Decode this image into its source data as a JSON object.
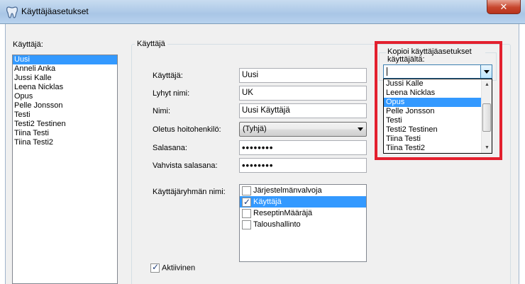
{
  "window": {
    "title": "Käyttäjäasetukset",
    "close_label": "✕"
  },
  "user_list": {
    "label": "Käyttäjä:",
    "items": [
      "Uusi",
      "Anneli Anka",
      "Jussi Kalle",
      "Leena Nicklas",
      "Opus",
      "Pelle Jonsson",
      "Testi",
      "Testi2 Testinen",
      "Tiina Testi",
      "Tiina Testi2"
    ],
    "selected_index": 0
  },
  "user_group": {
    "title": "Käyttäjä"
  },
  "form": {
    "username_label": "Käyttäjä:",
    "username_value": "Uusi",
    "shortname_label": "Lyhyt nimi:",
    "shortname_value": "UK",
    "name_label": "Nimi:",
    "name_value": "Uusi Käyttäjä",
    "caretaker_label": "Oletus hoitohenkilö:",
    "caretaker_value": "(Tyhjä)",
    "password_label": "Salasana:",
    "password_value": "••••••••",
    "confirm_label": "Vahvista salasana:",
    "confirm_value": "••••••••",
    "groups_label": "Käyttäjäryhmän nimi:",
    "groups": [
      {
        "label": "Järjestelmänvalvoja",
        "checked": false
      },
      {
        "label": "Käyttäjä",
        "checked": true
      },
      {
        "label": "ReseptinMääräjä",
        "checked": false
      },
      {
        "label": "Taloushallinto",
        "checked": false
      }
    ],
    "active_label": "Aktiivinen",
    "active_checked": true
  },
  "copy_settings": {
    "title": "Kopioi käyttäjäasetukset käyttäjältä:",
    "combo_value": "",
    "options": [
      "Jussi Kalle",
      "Leena Nicklas",
      "Opus",
      "Pelle Jonsson",
      "Testi",
      "Testi2 Testinen",
      "Tiina Testi",
      "Tiina Testi2"
    ],
    "selected_index": 2
  },
  "colors": {
    "highlight": "#e3202e",
    "selection": "#3399ff"
  },
  "icons": {
    "app": "tooth-icon",
    "close": "close-icon",
    "dropdown": "chevron-down-icon"
  }
}
